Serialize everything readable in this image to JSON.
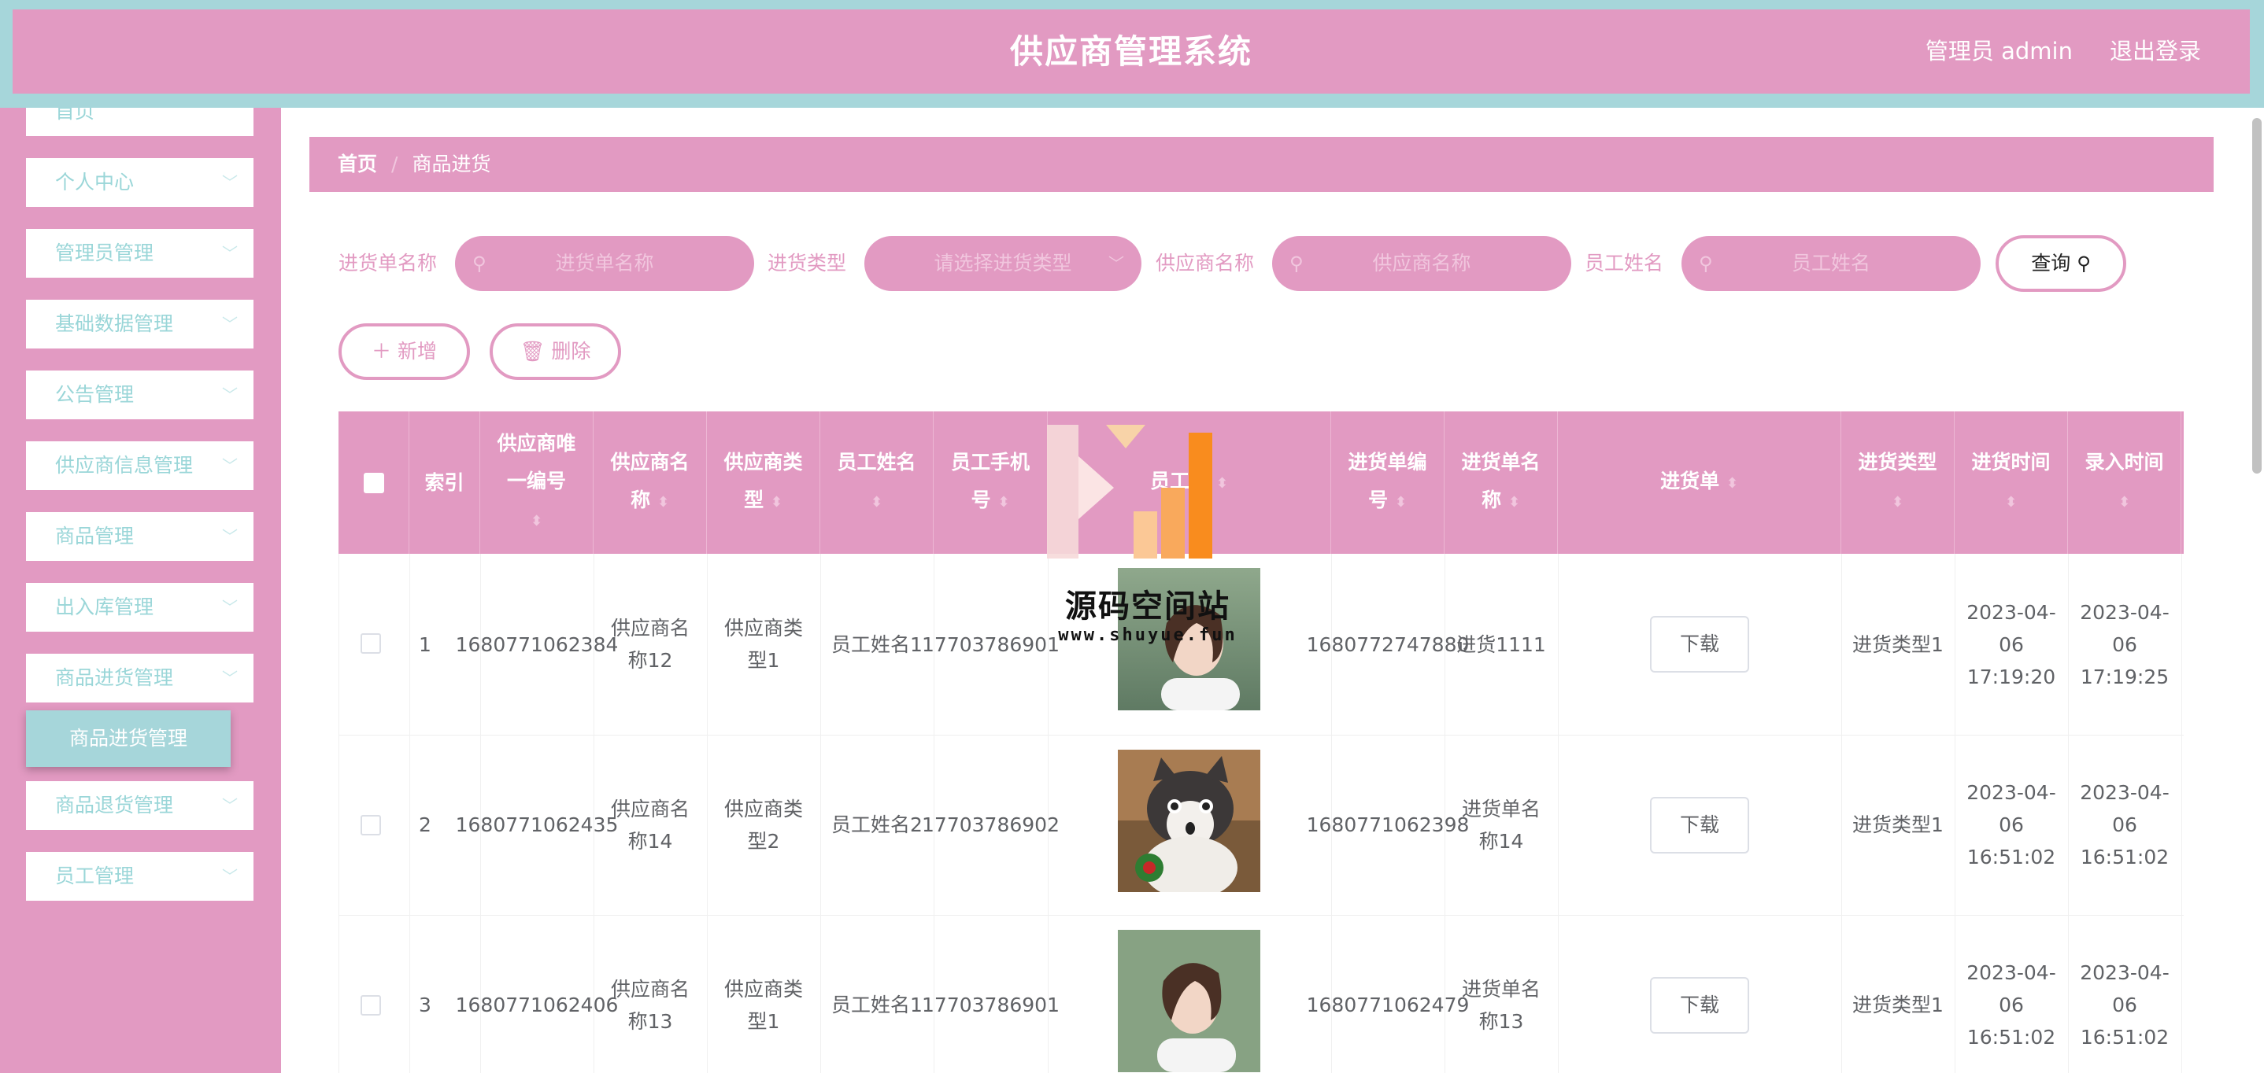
{
  "header": {
    "title": "供应商管理系统",
    "user": "管理员 admin",
    "logout": "退出登录"
  },
  "sidebar": {
    "items": [
      {
        "label": "首页"
      },
      {
        "label": "个人中心"
      },
      {
        "label": "管理员管理"
      },
      {
        "label": "基础数据管理"
      },
      {
        "label": "公告管理"
      },
      {
        "label": "供应商信息管理"
      },
      {
        "label": "商品管理"
      },
      {
        "label": "出入库管理"
      },
      {
        "label": "商品进货管理"
      },
      {
        "label": "商品退货管理"
      },
      {
        "label": "员工管理"
      }
    ],
    "submenu_active": "商品进货管理",
    "chevron_icon": "chevron-down-icon"
  },
  "breadcrumb": {
    "home": "首页",
    "separator": "/",
    "current": "商品进货"
  },
  "search": {
    "f1_label": "进货单名称",
    "f1_placeholder": "进货单名称",
    "f2_label": "进货类型",
    "f2_placeholder": "请选择进货类型",
    "f3_label": "供应商名称",
    "f3_placeholder": "供应商名称",
    "f4_label": "员工姓名",
    "f4_placeholder": "员工姓名",
    "query": "查询"
  },
  "actions": {
    "add": "新增",
    "delete": "删除"
  },
  "table": {
    "headers": {
      "index": "索引",
      "supplier_id": "供应商唯一编号",
      "supplier_name": "供应商名称",
      "supplier_type": "供应商类型",
      "staff_name": "员工姓名",
      "staff_phone": "员工手机号",
      "staff_photo": "员工头",
      "order_no": "进货单编号",
      "order_name": "进货单名称",
      "order_file": "进货单",
      "order_type": "进货类型",
      "order_time": "进货时间",
      "entry_time": "录入时间"
    },
    "download": "下载",
    "rows": [
      {
        "index": "1",
        "supplier_id": "1680771062384",
        "supplier_name": "供应商名称12",
        "supplier_type": "供应商类型1",
        "staff_name": "员工姓名1",
        "staff_phone": "17703786901",
        "order_no": "1680772747880",
        "order_name": "进货1111",
        "order_type": "进货类型1",
        "order_time": "2023-04-06 17:19:20",
        "entry_time": "2023-04-06 17:19:25"
      },
      {
        "index": "2",
        "supplier_id": "1680771062435",
        "supplier_name": "供应商名称14",
        "supplier_type": "供应商类型2",
        "staff_name": "员工姓名2",
        "staff_phone": "17703786902",
        "order_no": "1680771062398",
        "order_name": "进货单名称14",
        "order_type": "进货类型1",
        "order_time": "2023-04-06 16:51:02",
        "entry_time": "2023-04-06 16:51:02"
      },
      {
        "index": "3",
        "supplier_id": "1680771062406",
        "supplier_name": "供应商名称13",
        "supplier_type": "供应商类型1",
        "staff_name": "员工姓名1",
        "staff_phone": "17703786901",
        "order_no": "1680771062479",
        "order_name": "进货单名称13",
        "order_type": "进货类型1",
        "order_time": "2023-04-06 16:51:02",
        "entry_time": "2023-04-06 16:51:02"
      }
    ]
  },
  "watermark": {
    "text": "源码空间站",
    "url": "www.shuyue.fun"
  },
  "colors": {
    "primary_pink": "#e29ac2",
    "accent_teal": "#a6d6da",
    "menu_text": "#9ad6d8"
  }
}
